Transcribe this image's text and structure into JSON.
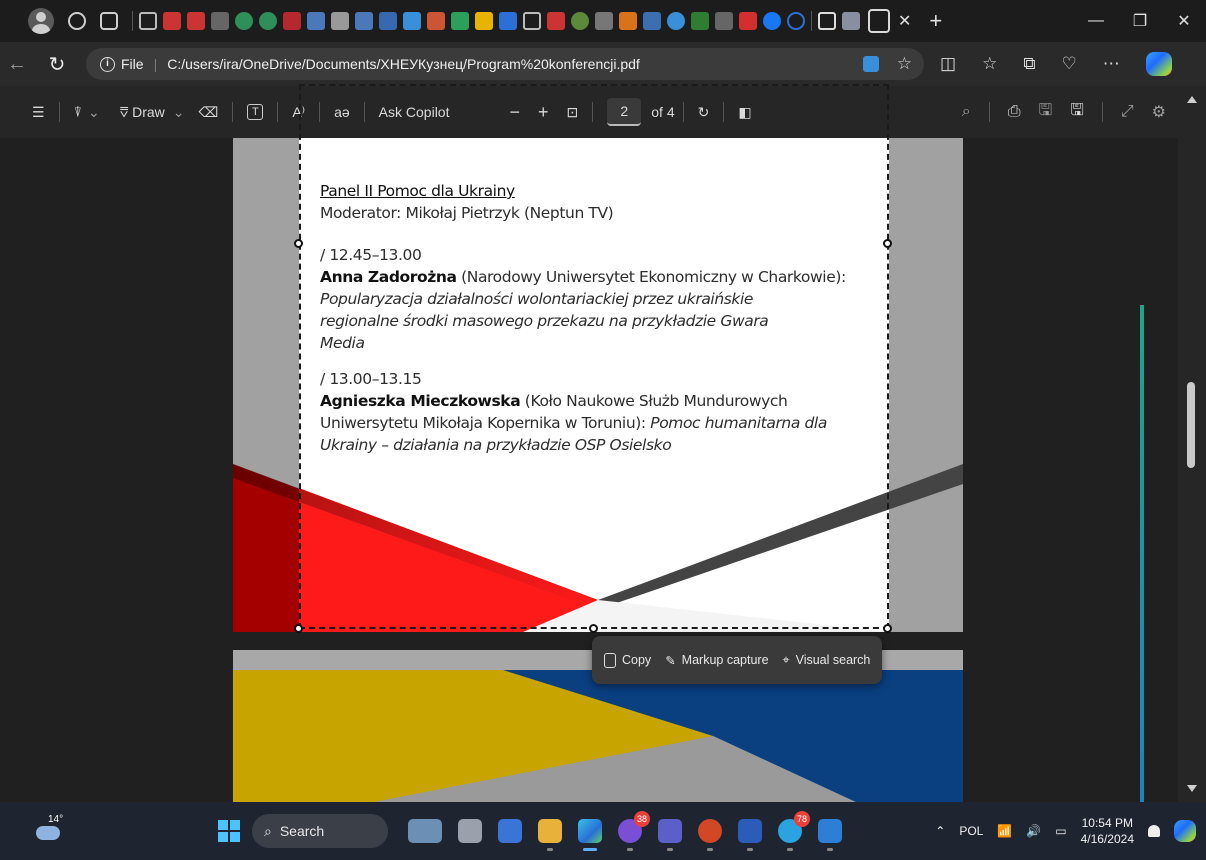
{
  "browser": {
    "address": {
      "info_label": "File",
      "url": "C:/users/ira/OneDrive/Documents/ХНЕУКузнец/Program%20konferencji.pdf"
    }
  },
  "pdf_toolbar": {
    "draw_label": "Draw",
    "read_aloud_label": "A⁾",
    "translate_label": "aə",
    "ask_copilot_label": "Ask Copilot",
    "zoom_out": "−",
    "zoom_in": "+",
    "page_number": "2",
    "page_total": "of 4"
  },
  "document": {
    "panel_title": "Panel II Pomoc dla Ukrainy",
    "moderator": "Moderator: Mikołaj Pietrzyk (Neptun TV)",
    "talks": [
      {
        "time": "/ 12.45–13.00",
        "speaker": "Anna Zadorożna",
        "affiliation": " (Narodowy Uniwersytet Ekonomiczny w Charkowie):",
        "title": "Popularyzacja działalności wolontariackiej przez ukraińskie regionalne środki masowego przekazu na przykładzie Gwara Media"
      },
      {
        "time": "/ 13.00–13.15",
        "speaker": "Agnieszka Mieczkowska",
        "affiliation": " (Koło Naukowe Służb Mundurowych Uniwersytetu Mikołaja Kopernika w Toruniu): ",
        "title": "Pomoc humanitarna dla Ukrainy – działania na przykładzie OSP Osielsko"
      }
    ]
  },
  "capture_menu": {
    "copy": "Copy",
    "markup": "Markup capture",
    "visual_search": "Visual search"
  },
  "taskbar": {
    "temperature": "14°",
    "search_placeholder": "Search",
    "badges": {
      "viber": "38",
      "telegram": "78"
    },
    "tray": {
      "language": "POL",
      "time": "10:54 PM",
      "date": "4/16/2024"
    }
  },
  "colors": {
    "accent_red": "#ff1a1a",
    "dark_red": "#a40000",
    "accent_yellow": "#c7a400",
    "accent_blue": "#0a3f80",
    "teal": "#1fa58a"
  }
}
